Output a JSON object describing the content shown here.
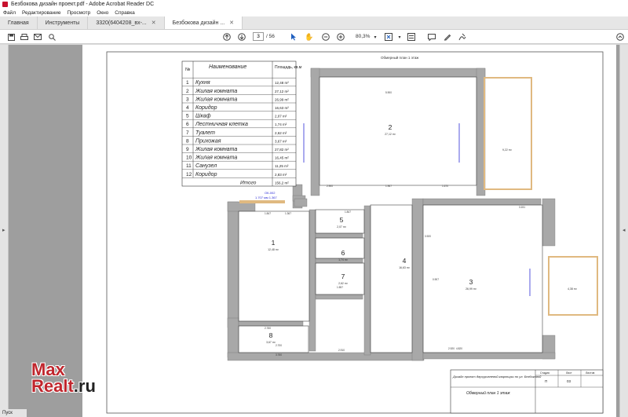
{
  "window": {
    "title": "Безбокова дизайн проект.pdf - Adobe Acrobat Reader DC"
  },
  "menu": {
    "items": [
      "Файл",
      "Редактирование",
      "Просмотр",
      "Окно",
      "Справка"
    ]
  },
  "tabs": {
    "items": [
      {
        "label": "Главная"
      },
      {
        "label": "Инструменты"
      },
      {
        "label": "3320(6404208_вх-..."
      },
      {
        "label": "Безбокова дизайн ..."
      }
    ]
  },
  "toolbar": {
    "page_current": "3",
    "page_total": "/ 56",
    "zoom": "80,3%"
  },
  "taskbar": {
    "start": "Пуск"
  },
  "watermark": {
    "line1": "Max",
    "line2": "Realt",
    "line2_suffix": ".ru"
  },
  "drawing": {
    "plan_title": "Обмерный план 1 этаж",
    "table_header_no": "№",
    "table_header_name": "Наименование",
    "table_header_area": "Площадь, кв.м",
    "rooms": [
      {
        "no": "1",
        "name": "Кухня",
        "area": "12,48 m²"
      },
      {
        "no": "2",
        "name": "Жилая комната",
        "area": "27,12 m²"
      },
      {
        "no": "3",
        "name": "Жилая комната",
        "area": "26,99 m²"
      },
      {
        "no": "4",
        "name": "Коридор",
        "area": "16,63 m²"
      },
      {
        "no": "5",
        "name": "Шкаф",
        "area": "2,07 m²"
      },
      {
        "no": "6",
        "name": "Лестничная клетка",
        "area": "1,74 m²"
      },
      {
        "no": "7",
        "name": "Туалет",
        "area": "2,62 m²"
      },
      {
        "no": "8",
        "name": "Прихожая",
        "area": "3,67 m²"
      },
      {
        "no": "9",
        "name": "Жилая комната",
        "area": "27,82 m²"
      },
      {
        "no": "10",
        "name": "Жилая комната",
        "area": "16,45 m²"
      },
      {
        "no": "11",
        "name": "Санузел",
        "area": "11,25 m²"
      },
      {
        "no": "12",
        "name": "Коридор",
        "area": "2,83 m²"
      }
    ],
    "total_label": "Итого",
    "total_area": "156,2 m²",
    "window_label_1": "ОК-002",
    "window_label_2": "1.707 мм 1.367",
    "room_labels": [
      {
        "no": "1",
        "area": "12,48 m²"
      },
      {
        "no": "2",
        "area": "27,12 m²"
      },
      {
        "no": "3",
        "area": "26,99 m²"
      },
      {
        "no": "4",
        "area": "16,63 m²"
      },
      {
        "no": "5",
        "area": "2,07 m²"
      },
      {
        "no": "6",
        "area": "1,74 m²"
      },
      {
        "no": "7",
        "area": "2,62 m²"
      },
      {
        "no": "8",
        "area": "3,67 m²"
      }
    ],
    "balcony_1_area": "9,22 m²",
    "balcony_2_area": "4,38 m²",
    "dims": [
      "5.900",
      "2.900",
      "1.967",
      "1.670",
      "2.920",
      "1.847",
      "1.367",
      "3.920",
      "2.910",
      "3.151",
      "4.820",
      "2.700",
      "1.557",
      "0.907",
      "2.760",
      "1.847",
      "3.760"
    ],
    "title_block": {
      "project": "Дизайн проект двухуровневой квартиры по ул. Безбоковой",
      "col_stage": "Стадия",
      "col_sheet": "Лист",
      "col_sheets": "Листов",
      "stage": "П",
      "sheet": "03",
      "sheet_title": "Обмерный план 1 этаж"
    }
  },
  "colors": {
    "accent": "#c0262d",
    "wall": "#a8a8a8",
    "balcony": "#e0b980",
    "window_blue": "#2b2bd6"
  }
}
